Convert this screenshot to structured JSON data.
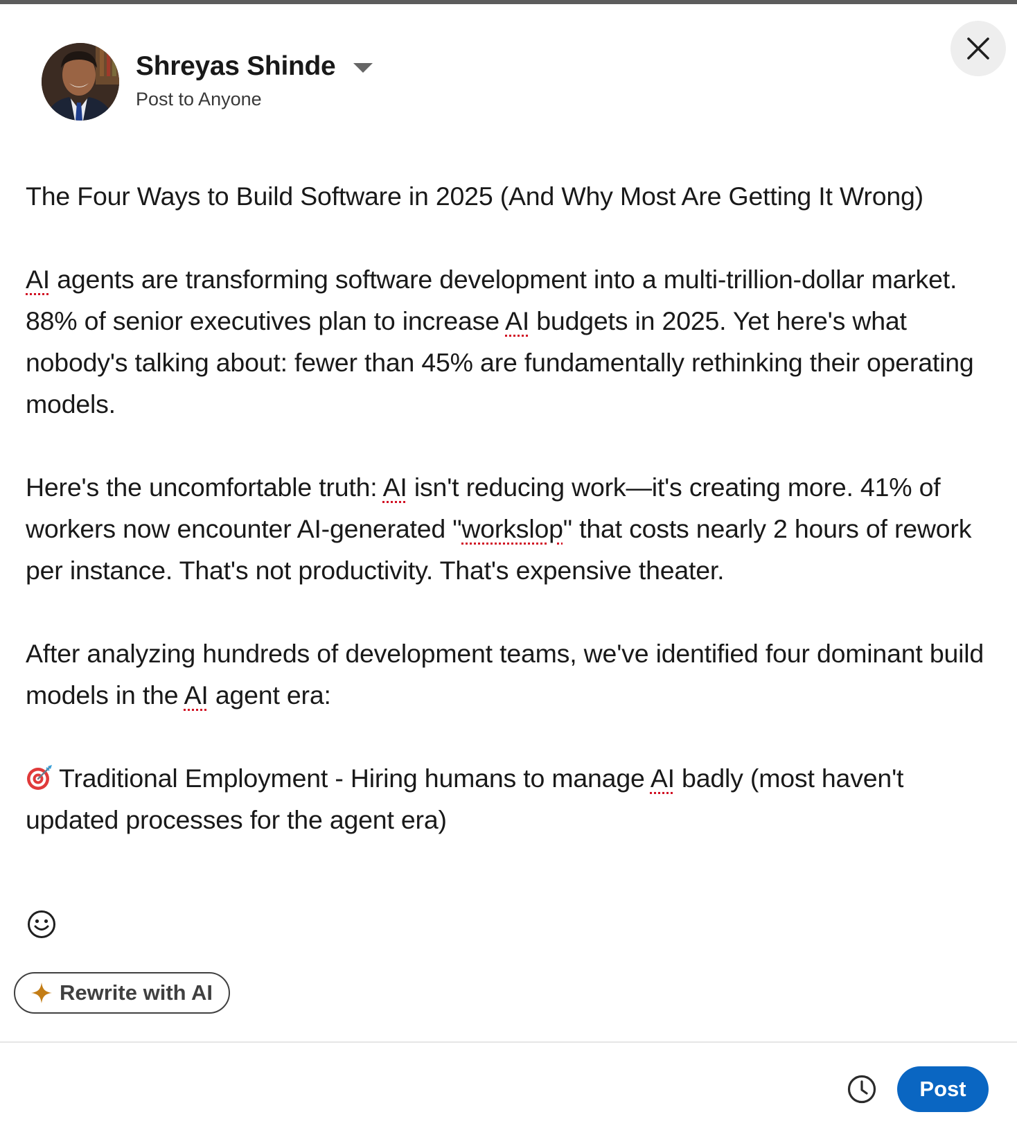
{
  "composer": {
    "author_name": "Shreyas Shinde",
    "audience": "Post to Anyone"
  },
  "post": {
    "title": "The Four Ways to Build Software in 2025 (And Why Most Are Getting It Wrong)",
    "p1": {
      "w_ai": "AI",
      "a": " agents are transforming software development into a multi-trillion-dollar market. 88% of senior executives plan to increase ",
      "w_ai2": "AI",
      "b": " budgets in 2025. Yet here's what nobody's talking about: fewer than 45% are fundamentally rethinking their operating models."
    },
    "p2": {
      "a": "Here's the uncomfortable truth: ",
      "w_ai": "AI",
      "b": " isn't reducing work—it's creating more. 41% of workers now encounter AI-generated \"",
      "w_workslop": "workslop",
      "c": "\" that costs nearly 2 hours of rework per instance. That's not productivity. That's expensive theater."
    },
    "p3": {
      "a": "After analyzing hundreds of development teams, we've identified four dominant build models in the ",
      "w_ai": "AI",
      "b": " agent era:"
    },
    "p4": {
      "a": "Traditional Employment - Hiring humans to manage ",
      "w_ai": "AI",
      "b": " badly (most haven't updated processes for the agent era)"
    }
  },
  "actions": {
    "rewrite_label": "Rewrite with AI",
    "post_label": "Post"
  },
  "icons": {
    "close": "close-icon",
    "dropdown": "caret-down-icon",
    "emoji": "smiley-icon",
    "rewrite": "sparkle-icon",
    "schedule": "clock-icon",
    "bullet": "direct-hit-target-emoji"
  },
  "colors": {
    "primary": "#0a66c2",
    "spellcheck": "#d11124",
    "sparkle": "#c37d16"
  }
}
